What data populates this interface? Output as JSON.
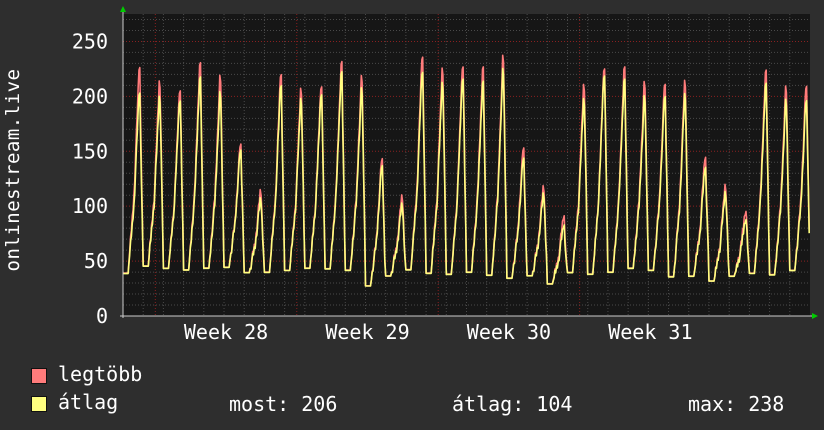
{
  "chart_data": {
    "type": "line",
    "ylabel": "onlinestream.live",
    "ylim": [
      0,
      275
    ],
    "yticks": [
      0,
      50,
      100,
      150,
      200,
      250
    ],
    "xticks": [
      "Week 28",
      "Week 29",
      "Week 30",
      "Week 31"
    ],
    "grid": true,
    "legend_placement": "bottom",
    "days": 34,
    "series": [
      {
        "name": "legtöbb",
        "color": "#ff7b7b",
        "daily_peaks": [
          240,
          225,
          218,
          242,
          228,
          163,
          118,
          233,
          218,
          222,
          243,
          228,
          150,
          113,
          250,
          238,
          242,
          238,
          248,
          160,
          122,
          95,
          222,
          240,
          238,
          222,
          222,
          225,
          152,
          125,
          100,
          235,
          218,
          220
        ],
        "daily_troughs": [
          35,
          42,
          40,
          38,
          40,
          42,
          38,
          36,
          38,
          40,
          39,
          38,
          25,
          35,
          38,
          35,
          34,
          36,
          33,
          32,
          35,
          28,
          36,
          34,
          36,
          40,
          38,
          32,
          34,
          30,
          35,
          35,
          34,
          38
        ]
      },
      {
        "name": "átlag",
        "color": "#ffff80",
        "daily_peaks": [
          215,
          210,
          208,
          228,
          212,
          157,
          110,
          222,
          208,
          214,
          233,
          216,
          143,
          105,
          235,
          224,
          230,
          224,
          235,
          150,
          115,
          86,
          208,
          233,
          226,
          208,
          210,
          212,
          142,
          118,
          92,
          222,
          205,
          206
        ],
        "daily_troughs": [
          35,
          42,
          40,
          38,
          40,
          42,
          38,
          36,
          38,
          40,
          39,
          38,
          25,
          35,
          38,
          35,
          34,
          36,
          33,
          32,
          35,
          28,
          36,
          34,
          36,
          40,
          38,
          32,
          34,
          30,
          35,
          35,
          34,
          38
        ]
      }
    ]
  },
  "legend": {
    "items": [
      {
        "label": "legtöbb",
        "color": "#ff7b7b"
      },
      {
        "label": "átlag",
        "color": "#ffff80"
      }
    ],
    "stats": [
      {
        "key": "most:",
        "value": "206"
      },
      {
        "key": "átlag:",
        "value": "104"
      },
      {
        "key": "max:",
        "value": "238"
      }
    ]
  },
  "colors": {
    "background": "#2e2e2e",
    "plot": "#161616",
    "grid_minor": "#4a4a4a",
    "grid_major": "#8a2020",
    "axis_arrow": "#00cc00"
  }
}
